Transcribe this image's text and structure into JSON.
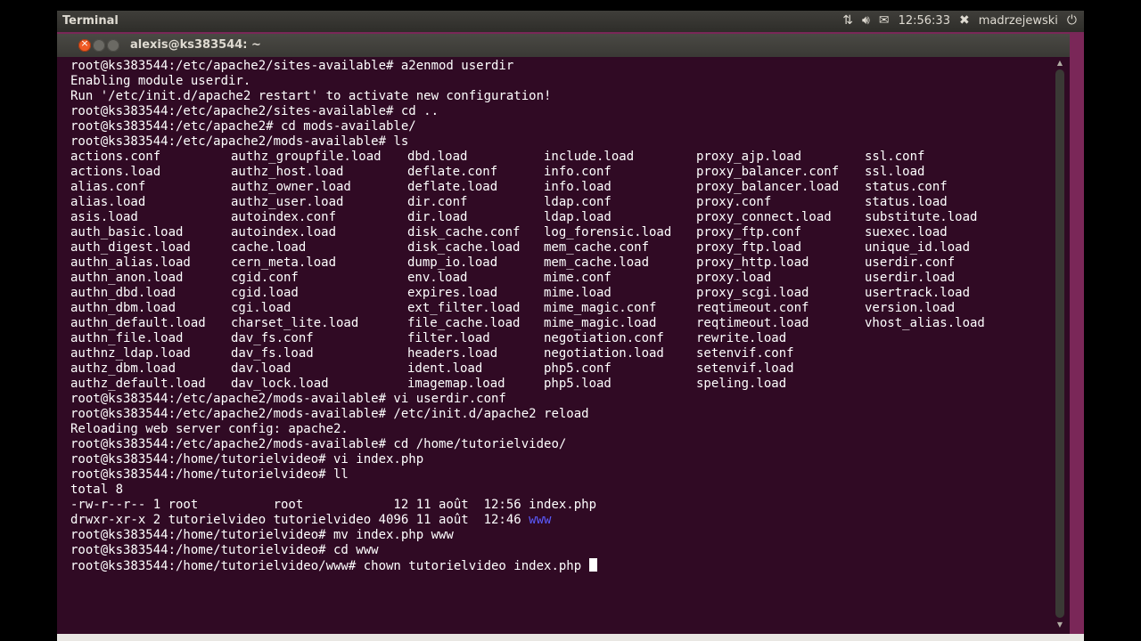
{
  "topbar": {
    "app_title": "Terminal",
    "network_icon": "network-arrows-icon",
    "sound_icon": "speaker-icon",
    "mail_icon": "envelope-icon",
    "time": "12:56:33",
    "user_icon": "user-x-icon",
    "user": "madrzejewski",
    "power_icon": "power-icon"
  },
  "window": {
    "title": "alexis@ks383544: ~",
    "close_glyph": "×"
  },
  "terminal": {
    "lines_before": [
      "root@ks383544:/etc/apache2/sites-available# a2enmod userdir",
      "Enabling module userdir.",
      "Run '/etc/init.d/apache2 restart' to activate new configuration!",
      "root@ks383544:/etc/apache2/sites-available# cd ..",
      "root@ks383544:/etc/apache2# cd mods-available/",
      "root@ks383544:/etc/apache2/mods-available# ls"
    ],
    "ls_rows": [
      [
        "actions.conf",
        "authz_groupfile.load",
        "dbd.load",
        "include.load",
        "proxy_ajp.load",
        "ssl.conf"
      ],
      [
        "actions.load",
        "authz_host.load",
        "deflate.conf",
        "info.conf",
        "proxy_balancer.conf",
        "ssl.load"
      ],
      [
        "alias.conf",
        "authz_owner.load",
        "deflate.load",
        "info.load",
        "proxy_balancer.load",
        "status.conf"
      ],
      [
        "alias.load",
        "authz_user.load",
        "dir.conf",
        "ldap.conf",
        "proxy.conf",
        "status.load"
      ],
      [
        "asis.load",
        "autoindex.conf",
        "dir.load",
        "ldap.load",
        "proxy_connect.load",
        "substitute.load"
      ],
      [
        "auth_basic.load",
        "autoindex.load",
        "disk_cache.conf",
        "log_forensic.load",
        "proxy_ftp.conf",
        "suexec.load"
      ],
      [
        "auth_digest.load",
        "cache.load",
        "disk_cache.load",
        "mem_cache.conf",
        "proxy_ftp.load",
        "unique_id.load"
      ],
      [
        "authn_alias.load",
        "cern_meta.load",
        "dump_io.load",
        "mem_cache.load",
        "proxy_http.load",
        "userdir.conf"
      ],
      [
        "authn_anon.load",
        "cgid.conf",
        "env.load",
        "mime.conf",
        "proxy.load",
        "userdir.load"
      ],
      [
        "authn_dbd.load",
        "cgid.load",
        "expires.load",
        "mime.load",
        "proxy_scgi.load",
        "usertrack.load"
      ],
      [
        "authn_dbm.load",
        "cgi.load",
        "ext_filter.load",
        "mime_magic.conf",
        "reqtimeout.conf",
        "version.load"
      ],
      [
        "authn_default.load",
        "charset_lite.load",
        "file_cache.load",
        "mime_magic.load",
        "reqtimeout.load",
        "vhost_alias.load"
      ],
      [
        "authn_file.load",
        "dav_fs.conf",
        "filter.load",
        "negotiation.conf",
        "rewrite.load",
        ""
      ],
      [
        "authnz_ldap.load",
        "dav_fs.load",
        "headers.load",
        "negotiation.load",
        "setenvif.conf",
        ""
      ],
      [
        "authz_dbm.load",
        "dav.load",
        "ident.load",
        "php5.conf",
        "setenvif.load",
        ""
      ],
      [
        "authz_default.load",
        "dav_lock.load",
        "imagemap.load",
        "php5.load",
        "speling.load",
        ""
      ]
    ],
    "lines_after": [
      "root@ks383544:/etc/apache2/mods-available# vi userdir.conf",
      "root@ks383544:/etc/apache2/mods-available# /etc/init.d/apache2 reload",
      "Reloading web server config: apache2.",
      "root@ks383544:/etc/apache2/mods-available# cd /home/tutorielvideo/",
      "root@ks383544:/home/tutorielvideo# vi index.php",
      "root@ks383544:/home/tutorielvideo# ll",
      "total 8",
      "-rw-r--r-- 1 root          root            12 11 août  12:56 index.php"
    ],
    "dir_line_prefix": "drwxr-xr-x 2 tutorielvideo tutorielvideo 4096 11 août  12:46 ",
    "dir_name": "www",
    "lines_end": [
      "root@ks383544:/home/tutorielvideo# mv index.php www",
      "root@ks383544:/home/tutorielvideo# cd www"
    ],
    "current_command": "root@ks383544:/home/tutorielvideo/www# chown tutorielvideo index.php "
  },
  "colors": {
    "terminal_bg": "#300a24",
    "text": "#ffffff",
    "directory": "#5b5bff",
    "close_button": "#f05a24"
  }
}
